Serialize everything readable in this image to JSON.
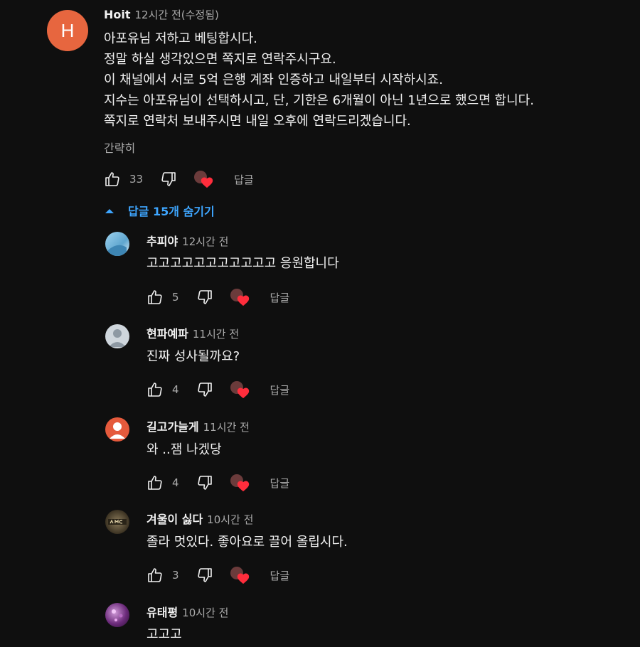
{
  "top_comment": {
    "avatar_letter": "H",
    "avatar_color": "#e7663f",
    "author": "Hoit",
    "timestamp": "12시간 전(수정됨)",
    "lines": [
      "아포유님 저하고 베팅합시다.",
      "정말 하실 생각있으면 쪽지로 연락주시구요.",
      "이 채널에서 서로 5억 은행 계좌 인증하고 내일부터 시작하시죠.",
      "지수는 아포유님이 선택하시고, 단, 기한은 6개월이 아닌 1년으로 했으면 합니다.",
      "쪽지로 연락처 보내주시면 내일 오후에 연락드리겠습니다."
    ],
    "collapse_label": "간략히",
    "likes": "33",
    "reply_label": "답글"
  },
  "replies_toggle": {
    "label": "답글 15개 숨기기",
    "color": "#3ea6ff"
  },
  "replies": [
    {
      "author": "추피야",
      "timestamp": "12시간 전",
      "text": "고고고고고고고고고고고 응원합니다",
      "likes": "5",
      "reply_label": "답글",
      "avatar": "sky"
    },
    {
      "author": "현파예파",
      "timestamp": "11시간 전",
      "text": "진짜 성사될까요?",
      "likes": "4",
      "reply_label": "답글",
      "avatar": "default"
    },
    {
      "author": "길고가늘게",
      "timestamp": "11시간 전",
      "text": "와 ..잼 나겠당",
      "likes": "4",
      "reply_label": "답글",
      "avatar": "orange"
    },
    {
      "author": "겨울이 싫다",
      "timestamp": "10시간 전",
      "text": "졸라 멋있다. 좋아요로 끌어 올립시다.",
      "likes": "3",
      "reply_label": "답글",
      "avatar": "amc"
    },
    {
      "author": "유태평",
      "timestamp": "10시간 전",
      "text": "고고고",
      "avatar": "purple"
    }
  ],
  "icons": {
    "like": "thumbs-up-icon",
    "dislike": "thumbs-down-icon",
    "heart": "creator-heart-icon",
    "toggle": "chevron-up-icon"
  }
}
